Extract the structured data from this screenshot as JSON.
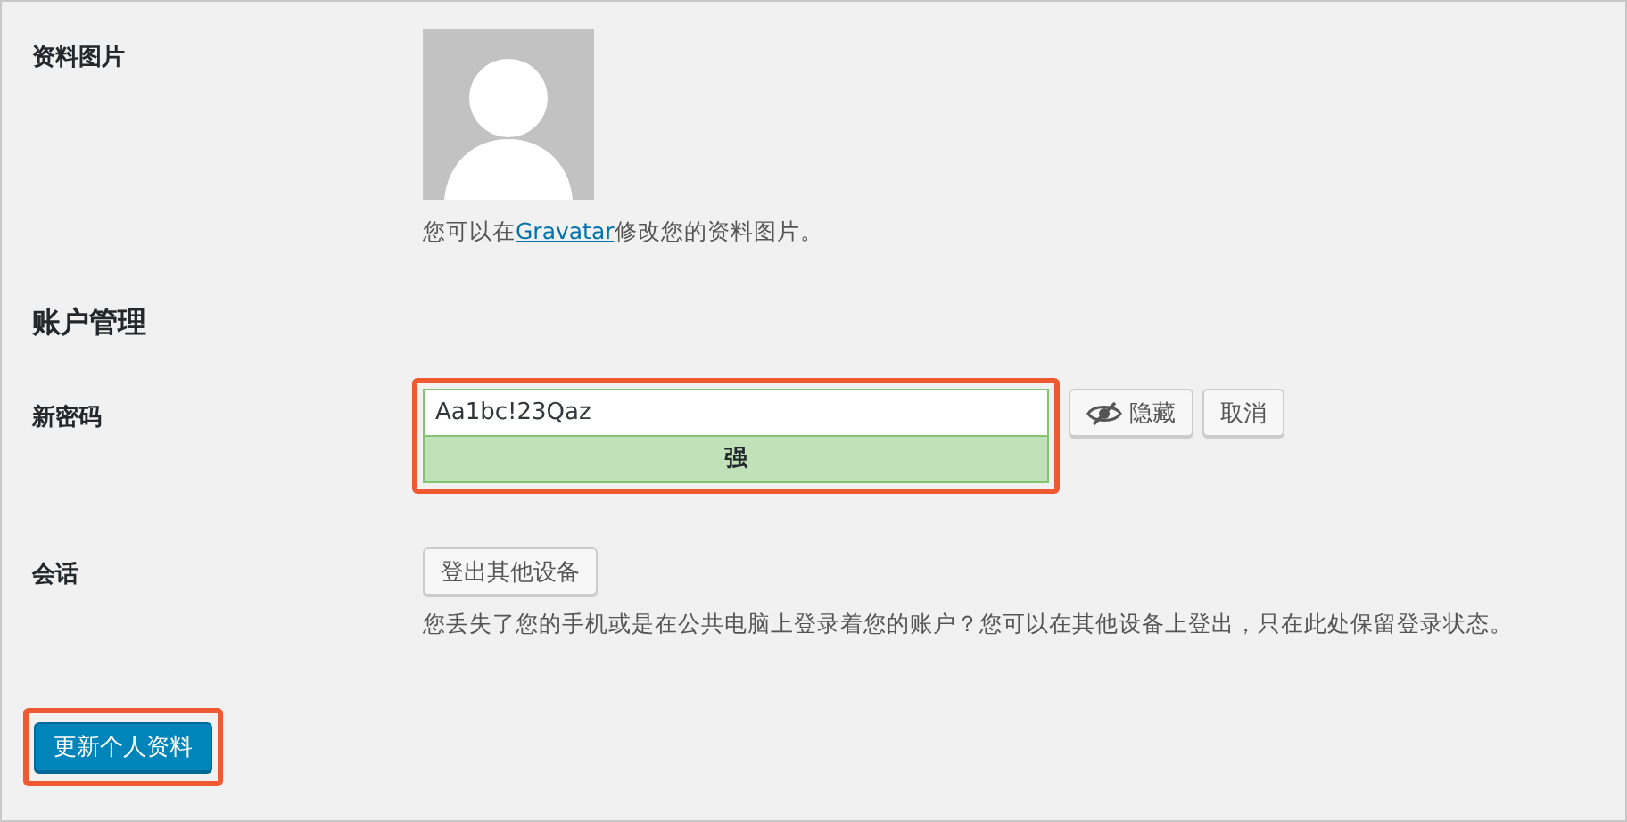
{
  "profile_picture": {
    "label": "资料图片",
    "description": {
      "before": "您可以在",
      "link": "Gravatar",
      "after": "修改您的资料图片。"
    }
  },
  "account_section": {
    "heading": "账户管理"
  },
  "new_password": {
    "label": "新密码",
    "value": "Aa1bc!23Qaz",
    "strength": {
      "kind": "strong",
      "label": "强"
    },
    "buttons": [
      {
        "kind": "toggle",
        "label": "隐藏"
      },
      {
        "kind": "plain",
        "label": "取消"
      }
    ]
  },
  "sessions": {
    "label": "会话",
    "button": "登出其他设备",
    "description": "您丢失了您的手机或是在公共电脑上登录着您的账户？您可以在其他设备上登出，只在此处保留登录状态。"
  },
  "submit_button": "更新个人资料"
}
